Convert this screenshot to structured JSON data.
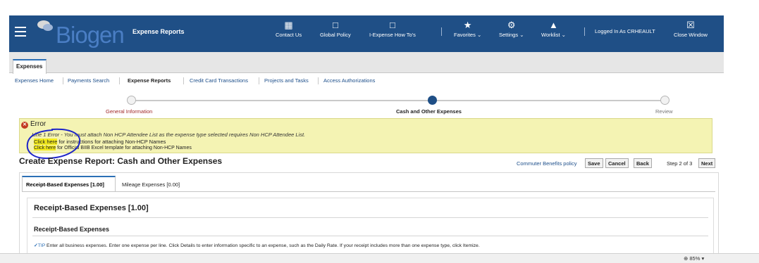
{
  "header": {
    "logo_text": "Biogen",
    "app_title": "Expense Reports",
    "nav": [
      {
        "label": "Contact Us",
        "icon": "contact-icon"
      },
      {
        "label": "Global Policy",
        "icon": "policy-doc-icon"
      },
      {
        "label": "I-Expense How To's",
        "icon": "howto-doc-icon"
      },
      {
        "label": "Favorites",
        "icon": "star-icon"
      },
      {
        "label": "Settings",
        "icon": "gear-icon"
      },
      {
        "label": "Worklist",
        "icon": "bell-icon"
      }
    ],
    "logged_in": "Logged In As CRHEAULT",
    "close_label": "Close Window"
  },
  "tabs": {
    "active": "Expenses"
  },
  "subnav": [
    "Expenses Home",
    "Payments Search",
    "Expense Reports",
    "Credit Card Transactions",
    "Projects and Tasks",
    "Access Authorizations"
  ],
  "train": {
    "steps": [
      "General Information",
      "Cash and Other Expenses",
      "Review"
    ],
    "current_index": 1
  },
  "error": {
    "title": "Error",
    "message": "Line 1 Error - You must attach Non HCP Attendee List as the expense type selected requires Non HCP Attendee List.",
    "link1_label": "Click here",
    "link1_text": " for instructions for attaching Non-HCP Names",
    "link2_label": "Click here",
    "link2_text": " for Official BIIB Excel template for attaching Non-HCP Names"
  },
  "page_title": "Create Expense Report: Cash and Other Expenses",
  "toolbar": {
    "policy_link": "Commuter Benefits policy",
    "save": "Save",
    "cancel": "Cancel",
    "back": "Back",
    "step": "Step 2 of 3",
    "next": "Next"
  },
  "panel_tabs": {
    "receipt": "Receipt-Based Expenses [1.00]",
    "mileage": "Mileage Expenses [0.00]"
  },
  "section": {
    "heading": "Receipt-Based Expenses [1.00]",
    "subheading": "Receipt-Based Expenses",
    "tip_label": "TIP",
    "tip_text": " Enter all business expenses. Enter one expense per line. Click Details to enter information specific to an expense, such as the Daily Rate. If your receipt includes more than one expense type, click Itemize."
  },
  "status": {
    "zoom": "85%"
  }
}
